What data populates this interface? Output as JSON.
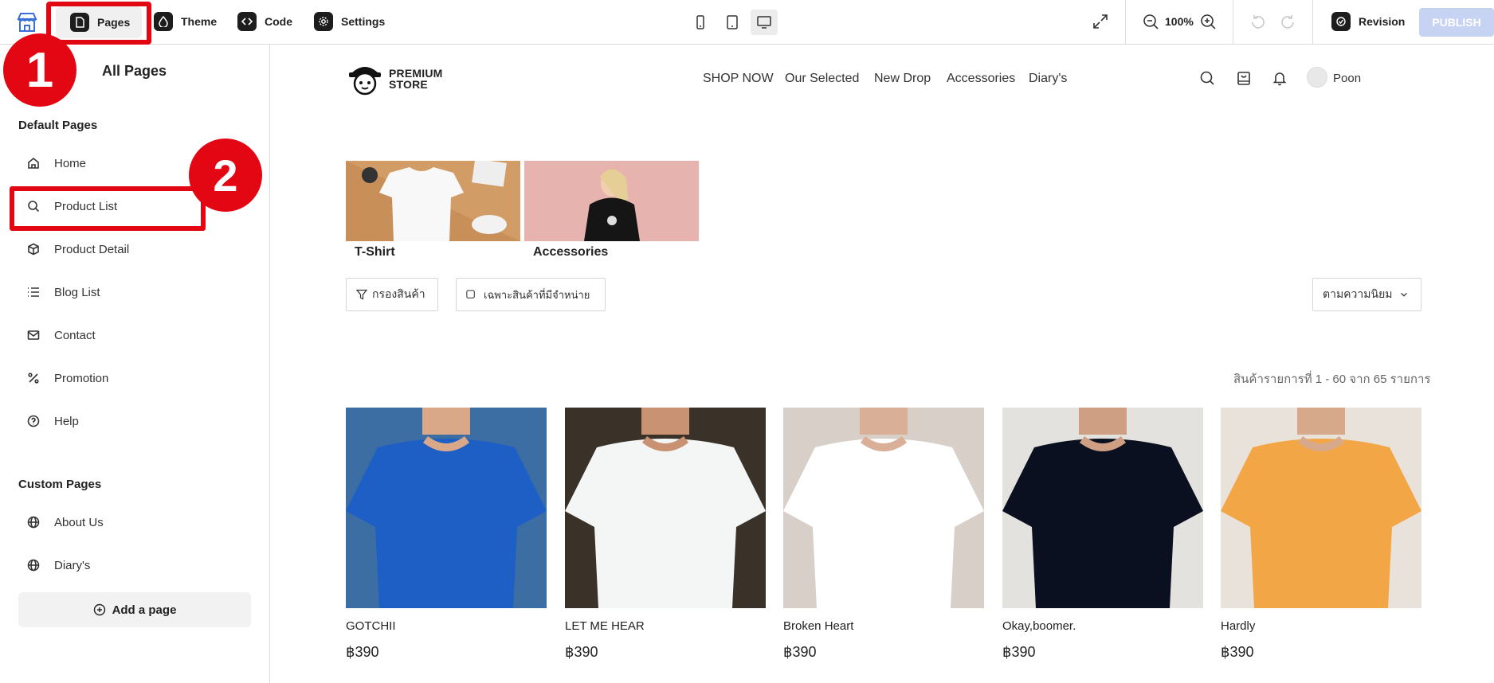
{
  "topbar": {
    "pages_label": "Pages",
    "theme_label": "Theme",
    "code_label": "Code",
    "settings_label": "Settings",
    "zoom": "100%",
    "revision_label": "Revision",
    "publish_label": "PUBLISH",
    "annotation_1": "1"
  },
  "sidebar": {
    "title": "All Pages",
    "default_title": "Default Pages",
    "default_pages": [
      "Home",
      "Product List",
      "Product Detail",
      "Blog List",
      "Contact",
      "Promotion",
      "Help"
    ],
    "custom_title": "Custom Pages",
    "custom_pages": [
      "About Us",
      "Diary's"
    ],
    "add_label": "Add a page",
    "annotation_2": "2"
  },
  "store": {
    "logo_line1": "PREMIUM",
    "logo_line2": "STORE",
    "menu": [
      "SHOP NOW",
      "Our Selected",
      "New Drop",
      "Accessories",
      "Diary's"
    ],
    "user": "Poon",
    "categories": [
      "T-Shirt",
      "Accessories"
    ],
    "filter_label": "กรองสินค้า",
    "instock_label": "เฉพาะสินค้าที่มีจำหน่าย",
    "sort_label": "ตามความนิยม",
    "count_text": "สินค้ารายการที่ 1 - 60 จาก 65 รายการ",
    "products": [
      {
        "name": "GOTCHII",
        "price": "฿390",
        "shirt_color": "#1d5fc4"
      },
      {
        "name": "LET ME HEAR",
        "price": "฿390",
        "shirt_color": "#f4f6f5"
      },
      {
        "name": "Broken Heart",
        "price": "฿390",
        "shirt_color": "#ffffff"
      },
      {
        "name": "Okay,boomer.",
        "price": "฿390",
        "shirt_color": "#0b1020"
      },
      {
        "name": "Hardly",
        "price": "฿390",
        "shirt_color": "#f2a646"
      }
    ]
  },
  "colors": {
    "annotation_red": "#e30613",
    "publish_bg": "#c7d3f3"
  }
}
